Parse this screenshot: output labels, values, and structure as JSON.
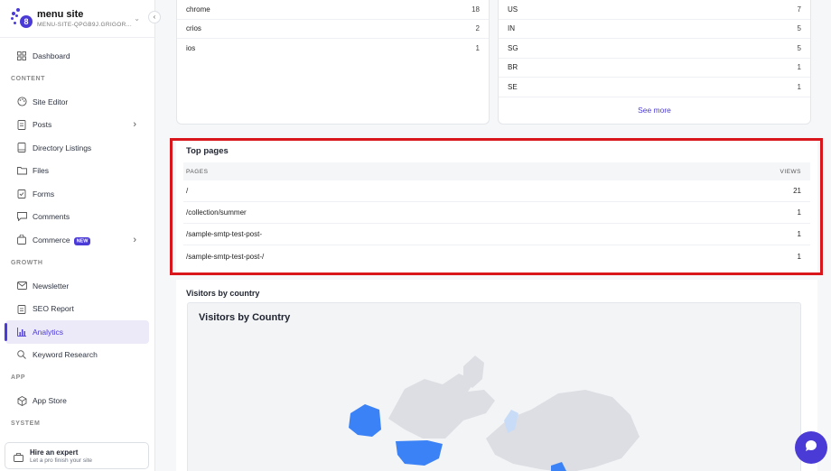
{
  "site": {
    "name": "menu site",
    "subdomain": "MENU-SITE-QPGB9J.GRIGOR..."
  },
  "sidebar": {
    "items": [
      {
        "label": "Dashboard"
      },
      {
        "section": "CONTENT"
      },
      {
        "label": "Site Editor"
      },
      {
        "label": "Posts"
      },
      {
        "label": "Directory Listings"
      },
      {
        "label": "Files"
      },
      {
        "label": "Forms"
      },
      {
        "label": "Comments"
      },
      {
        "label": "Commerce",
        "badge": "NEW"
      },
      {
        "section": "GROWTH"
      },
      {
        "label": "Newsletter"
      },
      {
        "label": "SEO Report"
      },
      {
        "label": "Analytics"
      },
      {
        "label": "Keyword Research"
      },
      {
        "section": "APP"
      },
      {
        "label": "App Store"
      },
      {
        "section": "SYSTEM"
      }
    ],
    "expert": {
      "title": "Hire an expert",
      "subtitle": "Let a pro finish your site"
    }
  },
  "browsers": [
    {
      "name": "chrome",
      "count": "18"
    },
    {
      "name": "crios",
      "count": "2"
    },
    {
      "name": "ios",
      "count": "1"
    }
  ],
  "countries": {
    "rows": [
      {
        "code": "US",
        "count": "7"
      },
      {
        "code": "IN",
        "count": "5"
      },
      {
        "code": "SG",
        "count": "5"
      },
      {
        "code": "BR",
        "count": "1"
      },
      {
        "code": "SE",
        "count": "1"
      }
    ],
    "see_more": "See more"
  },
  "top_pages": {
    "title": "Top pages",
    "col_pages": "PAGES",
    "col_views": "VIEWS",
    "rows": [
      {
        "page": "/",
        "views": "21"
      },
      {
        "page": "/collection/summer",
        "views": "1"
      },
      {
        "page": "/sample-smtp-test-post-",
        "views": "1"
      },
      {
        "page": "/sample-smtp-test-post-/",
        "views": "1"
      }
    ]
  },
  "visitors_by_country": {
    "label": "Visitors by country",
    "map_title": "Visitors by Country"
  },
  "colors": {
    "accent": "#4b3bd6",
    "map_highlight": "#3b82f6",
    "map_light": "#c9dcf7",
    "map_base": "#dcdee3",
    "highlight_box": "#d9161c"
  }
}
